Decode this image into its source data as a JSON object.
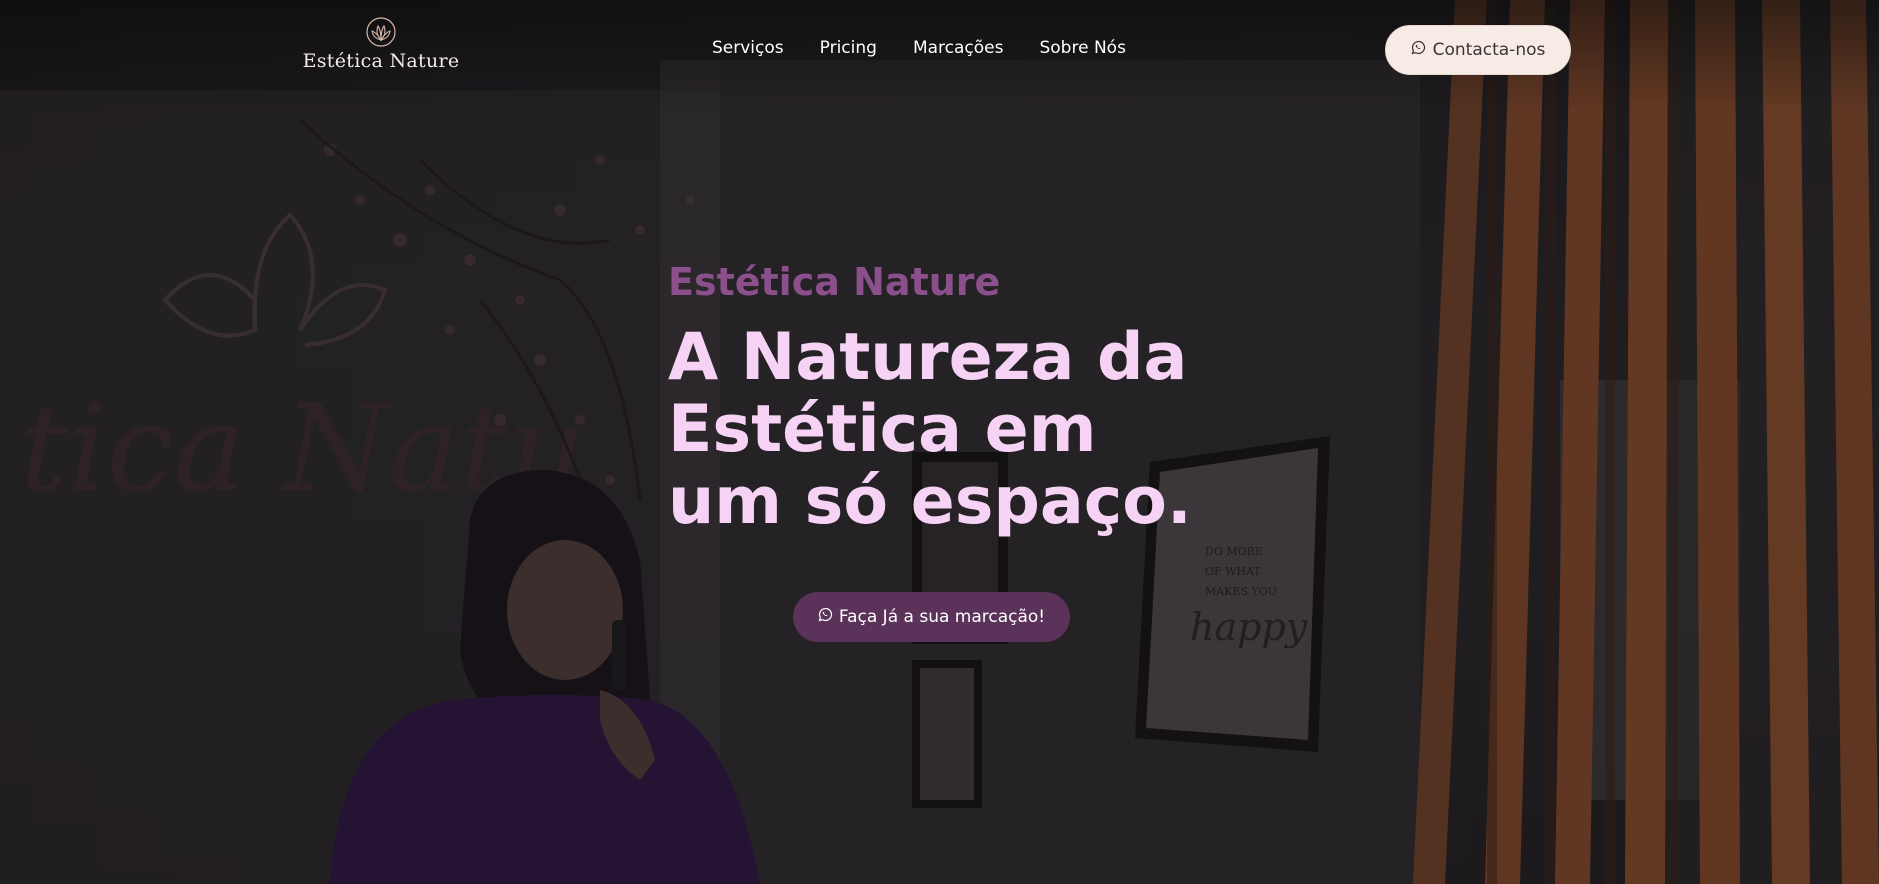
{
  "brand": {
    "name": "Estética Nature",
    "logo_icon": "lotus-icon"
  },
  "nav": {
    "items": [
      {
        "label": "Serviços"
      },
      {
        "label": "Pricing"
      },
      {
        "label": "Marcações"
      },
      {
        "label": "Sobre Nós"
      }
    ]
  },
  "header": {
    "contact_label": "Contacta-nos",
    "contact_icon": "whatsapp-icon"
  },
  "hero": {
    "eyebrow": "Estética Nature",
    "headline": "A Natureza da Estética em um só espaço.",
    "cta_label": "Faça Já a sua marcação!",
    "cta_icon": "whatsapp-icon",
    "background_sign": "Estética Nature",
    "poster_text": "DO MORE OF WHAT MAKES YOU happy"
  },
  "colors": {
    "eyebrow": "#8b4f8c",
    "headline": "#f6d3f5",
    "cta_bg": "#5b3259",
    "contact_bg": "#f7ebe6"
  }
}
